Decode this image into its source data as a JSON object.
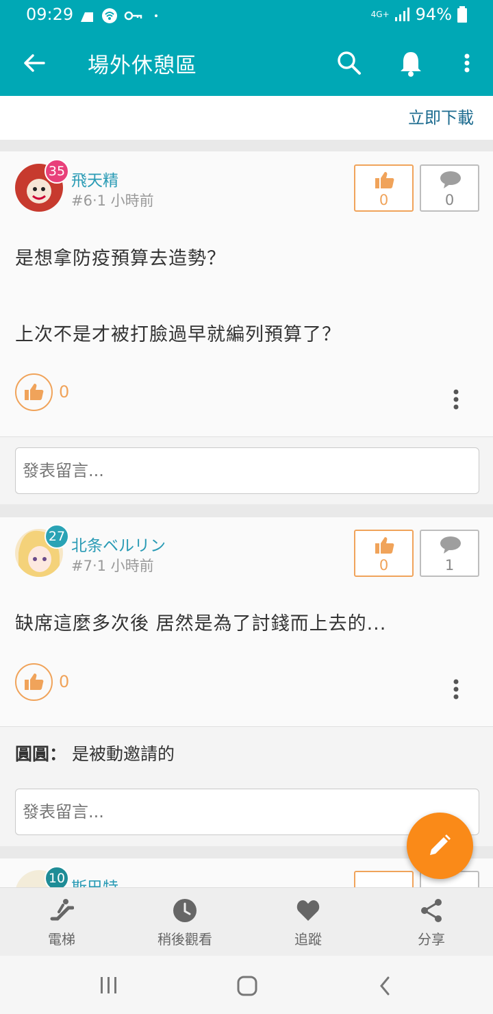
{
  "status_bar": {
    "time": "09:29",
    "network": "4G+",
    "battery": "94%"
  },
  "app_bar": {
    "title": "場外休憩區",
    "back_icon": "back-arrow-icon",
    "search_icon": "search-icon",
    "bell_icon": "bell-icon",
    "more_icon": "more-vert-icon"
  },
  "banner": {
    "download_label": "立即下載"
  },
  "posts": [
    {
      "user": "飛天精",
      "level": "35",
      "level_color": "#e8407a",
      "meta": "#6‧1 小時前",
      "likes": "0",
      "comments": "0",
      "body_line1": "是想拿防疫預算去造勢？",
      "body_line2": "上次不是才被打臉過早就編列預算了？",
      "reactions": "0"
    },
    {
      "user": "北条ベルリン",
      "level": "27",
      "level_color": "#2aa3b5",
      "meta": "#7‧1 小時前",
      "likes": "0",
      "comments": "1",
      "body_line1": "缺席這麼多次後 居然是為了討錢而上去的...",
      "reactions": "0",
      "reply_author": "圓圓",
      "reply_sep": "：",
      "reply_text": "是被動邀請的"
    },
    {
      "user": "斯巴特",
      "level": "10",
      "level_color": "#1e8c96"
    }
  ],
  "comment_placeholder": "發表留言...",
  "fab_icon": "pencil-icon",
  "bottom_nav": [
    {
      "label": "電梯",
      "icon": "escalator-icon"
    },
    {
      "label": "稍後觀看",
      "icon": "clock-icon"
    },
    {
      "label": "追蹤",
      "icon": "heart-icon"
    },
    {
      "label": "分享",
      "icon": "share-icon"
    }
  ],
  "colors": {
    "teal": "#00a8b5",
    "orange": "#fa8a18",
    "like_orange": "#f0a35a",
    "link_teal": "#2a9bb5"
  }
}
